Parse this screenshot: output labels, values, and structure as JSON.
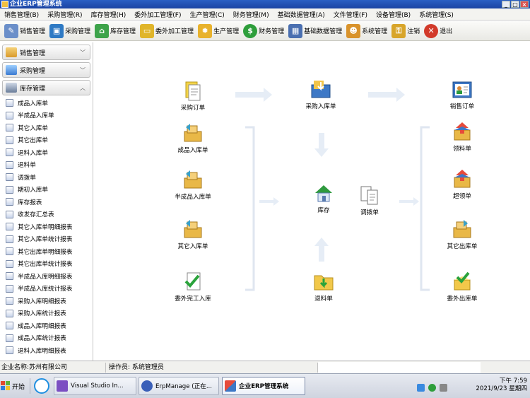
{
  "window": {
    "title": "企业ERP管理系统",
    "min": "_",
    "max": "□",
    "close": "×"
  },
  "menu": [
    "销售管理(B)",
    "采购管理(R)",
    "库存管理(H)",
    "委外加工管理(F)",
    "生产管理(C)",
    "财务管理(M)",
    "基础数据管理(A)",
    "文件管理(F)",
    "设备管理(B)",
    "系统管理(S)"
  ],
  "toolbar": [
    {
      "label": "销售管理",
      "icon": "edit-icon",
      "color": "#6b8fc9"
    },
    {
      "label": "采购管理",
      "icon": "basket-icon",
      "color": "#2f7ac4"
    },
    {
      "label": "库存管理",
      "icon": "house-icon",
      "color": "#3da34a"
    },
    {
      "label": "委外加工管理",
      "icon": "folder-icon",
      "color": "#e0b52a"
    },
    {
      "label": "生产管理",
      "icon": "gear-icon",
      "color": "#e8b22c"
    },
    {
      "label": "财务管理",
      "icon": "dollar-icon",
      "color": "#2e9e3b"
    },
    {
      "label": "基础数据管理",
      "icon": "calendar-icon",
      "color": "#4a6fb0"
    },
    {
      "label": "系统管理",
      "icon": "users-icon",
      "color": "#d9932b"
    },
    {
      "label": "注销",
      "icon": "key-icon",
      "color": "#d8a52a"
    },
    {
      "label": "退出",
      "icon": "exit-icon",
      "color": "#d23a2a"
    }
  ],
  "sidebar": {
    "groups": [
      {
        "label": "销售管理",
        "icon": "sales-group-icon",
        "state": "collapsed"
      },
      {
        "label": "采购管理",
        "icon": "purchase-group-icon",
        "state": "collapsed"
      },
      {
        "label": "库存管理",
        "icon": "inventory-group-icon",
        "state": "expanded"
      }
    ],
    "items": [
      "成品入库单",
      "半成品入库单",
      "其它入库单",
      "其它出库单",
      "退料入库单",
      "退料单",
      "调拨单",
      "期初入库单",
      "库存报表",
      "收发存汇总表",
      "其它入库单明细报表",
      "其它入库单统计报表",
      "其它出库单明细报表",
      "其它出库单统计报表",
      "半成品入库明细报表",
      "半成品入库统计报表",
      "采购入库明细报表",
      "采购入库统计报表",
      "成品入库明细报表",
      "成品入库统计报表",
      "退料入库明细报表"
    ]
  },
  "flow": {
    "nodes": {
      "purchase_order": "采购订单",
      "purchase_in": "采购入库单",
      "sales_order": "销售订单",
      "finished_in": "成品入库单",
      "semi_in": "半成品入库单",
      "other_in": "其它入库单",
      "outsource_in": "委外完工入库",
      "inventory": "库存",
      "transfer": "调拨单",
      "return_in": "退料单",
      "picking": "领料单",
      "over_picking": "超领单",
      "other_out": "其它出库单",
      "outsource_out": "委外出库单"
    }
  },
  "status": {
    "company_label": "企业名称:",
    "company": "苏州有限公司",
    "operator_label": "操作员:",
    "operator": "系统管理员"
  },
  "taskbar": {
    "start": "开始",
    "tasks": [
      "Visual Studio In...",
      "ErpManage (正在...",
      "企业ERP管理系统"
    ],
    "time": "下午 7:59",
    "date": "2021/9/23 星期四"
  }
}
